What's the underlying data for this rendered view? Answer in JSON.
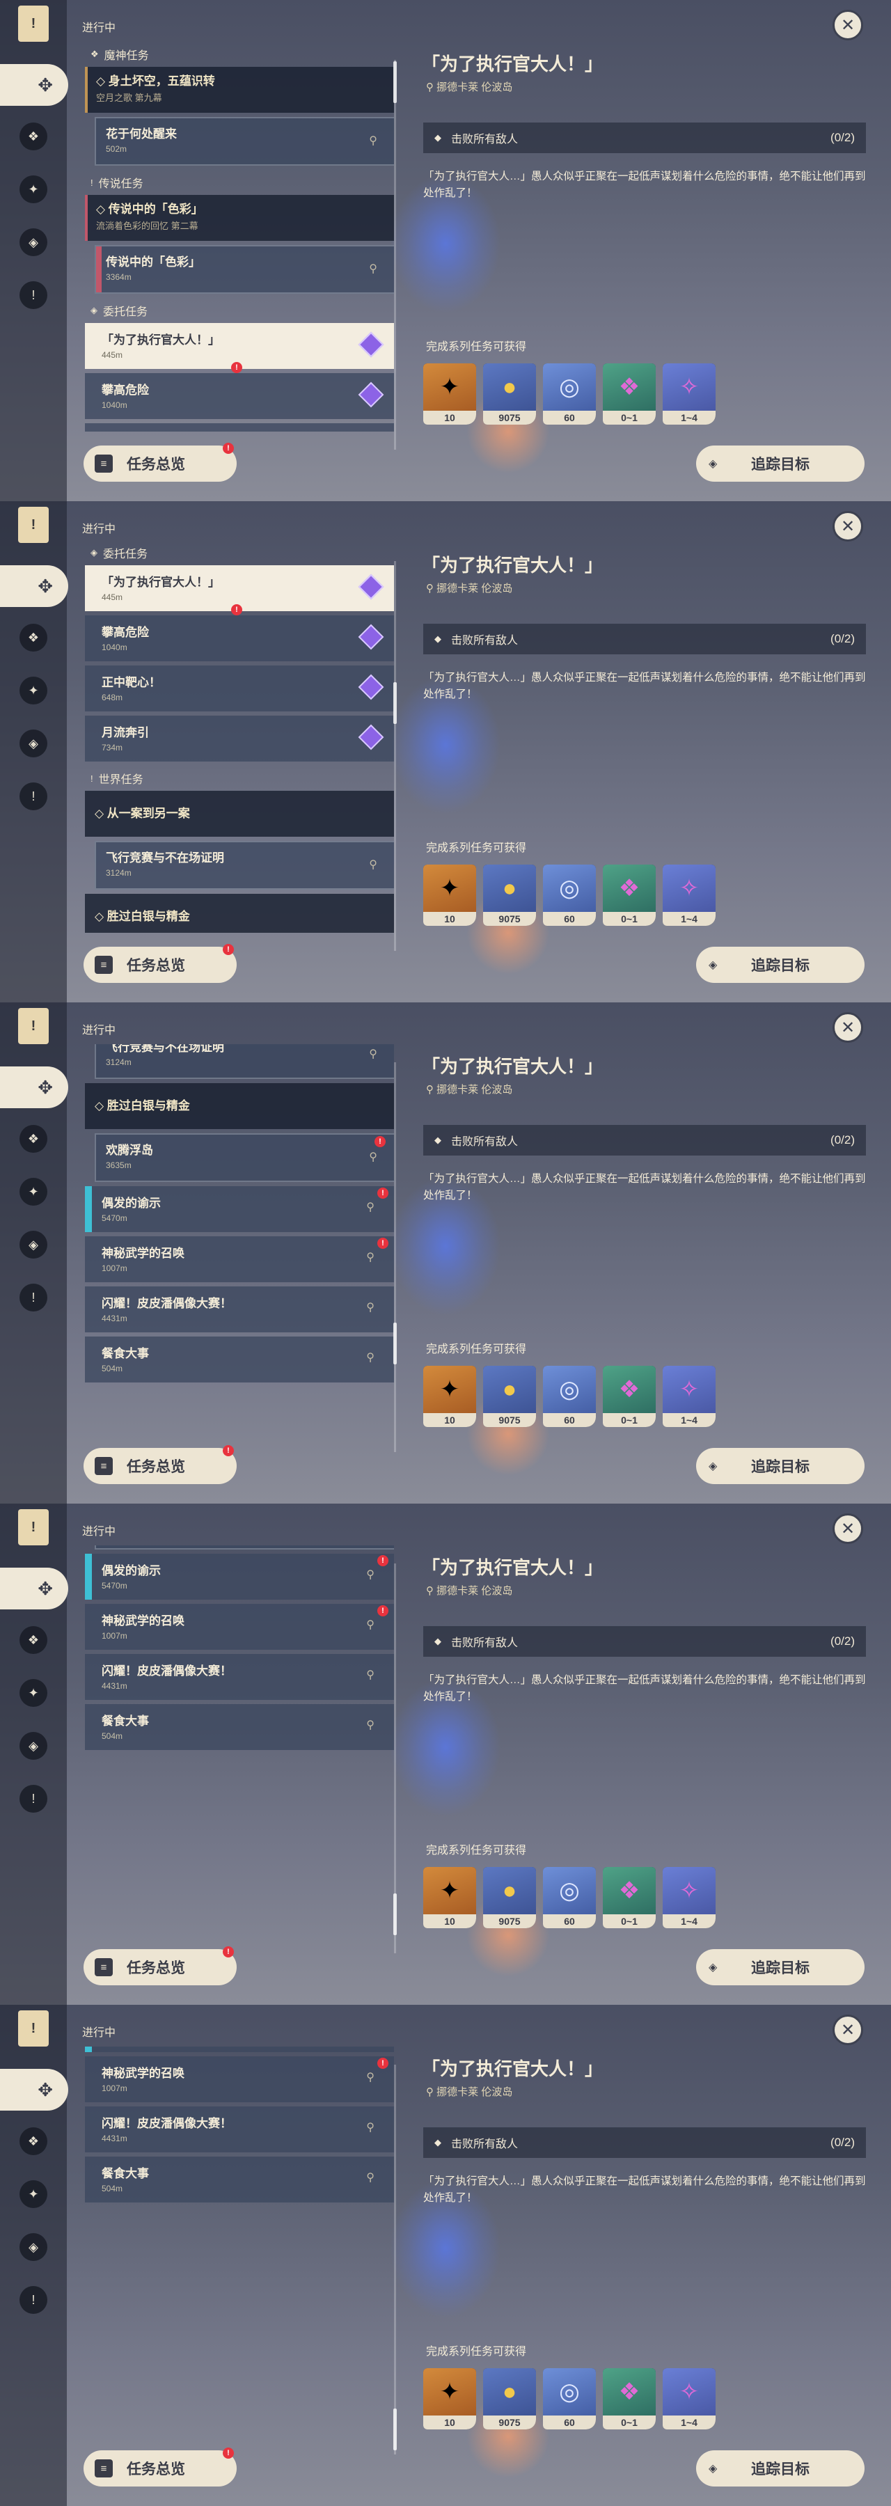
{
  "header": {
    "ongoing": "进行中",
    "close_label": "✕"
  },
  "categories": {
    "archon": "魔神任务",
    "legend": "传说任务",
    "commission": "委托任务",
    "world": "世界任务"
  },
  "quests": {
    "archon_main": {
      "title": "身土坏空，五蕴识转",
      "sub": "空月之歌 第九幕"
    },
    "archon_sub": {
      "title": "花于何处醒来",
      "dist": "502m"
    },
    "legend_main": {
      "title": "传说中的「色彩」",
      "sub": "流淌着色彩的回忆 第二幕"
    },
    "legend_sub": {
      "title": "传说中的「色彩」",
      "dist": "3364m"
    },
    "selected": {
      "title": "「为了执行官大人！」",
      "dist": "445m"
    },
    "climb": {
      "title": "攀高危险",
      "dist": "1040m"
    },
    "target": {
      "title": "正中靶心！",
      "dist": "648m"
    },
    "moon": {
      "title": "月流奔引",
      "dist": "734m"
    },
    "world_main": {
      "title": "从一案到另一案"
    },
    "flight": {
      "title": "飞行竞赛与不在场证明",
      "dist": "3124m"
    },
    "silver_main": {
      "title": "胜过白银与精金"
    },
    "joy": {
      "title": "欢腾浮岛",
      "dist": "3635m"
    },
    "revelation": {
      "title": "偶发的谕示",
      "dist": "5470m"
    },
    "martial": {
      "title": "神秘武学的召唤",
      "dist": "1007m"
    },
    "idol": {
      "title": "闪耀！皮皮潘偶像大赛！",
      "dist": "4431m"
    },
    "meal": {
      "title": "餐食大事",
      "dist": "504m"
    },
    "martial_cut": {
      "title": "神秘武学的召唤"
    }
  },
  "buttons": {
    "overview": "任务总览",
    "track": "追踪目标"
  },
  "detail": {
    "title": "「为了执行官大人！」",
    "location": "挪德卡莱 伦波岛",
    "objective": "击败所有敌人",
    "objective_count": "(0/2)",
    "description": "「为了执行官大人…」愚人众似乎正聚在一起低声谋划着什么危险的事情，绝不能让他们再到处作乱了！",
    "rewards_title": "完成系列任务可获得",
    "rewards": [
      {
        "icon": "star-dust-icon",
        "amount": "10"
      },
      {
        "icon": "mora-icon",
        "amount": "9075"
      },
      {
        "icon": "adventure-exp-icon",
        "amount": "60"
      },
      {
        "icon": "crystal-green-icon",
        "amount": "0~1"
      },
      {
        "icon": "crystal-cluster-icon",
        "amount": "1~4"
      }
    ]
  },
  "accent": {
    "archon": "#c09454",
    "legend": "#c1576a",
    "commission_gem": "#8c63e6",
    "event": "#3ec0d5",
    "alert": "#e8333e"
  }
}
